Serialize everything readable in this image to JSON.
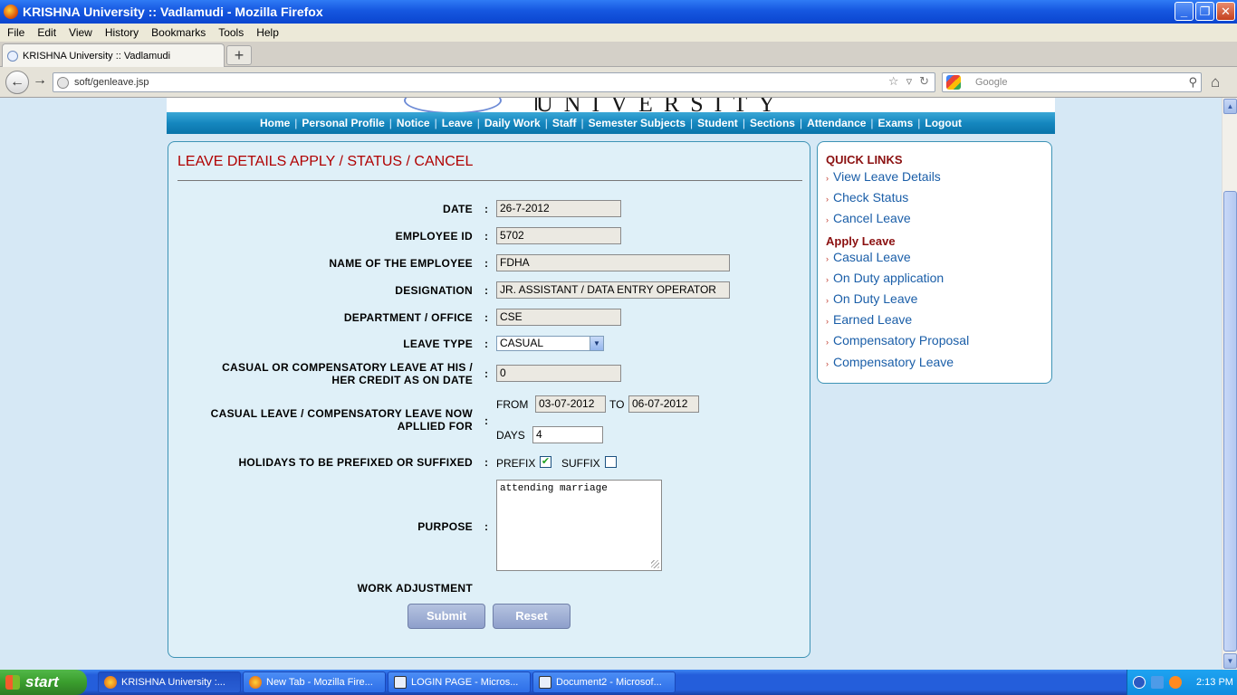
{
  "window": {
    "title": "KRISHNA University :: Vadlamudi - Mozilla Firefox"
  },
  "menu": [
    "File",
    "Edit",
    "View",
    "History",
    "Bookmarks",
    "Tools",
    "Help"
  ],
  "tab": {
    "title": "KRISHNA University :: Vadlamudi"
  },
  "address": {
    "url": "soft/genleave.jsp"
  },
  "search": {
    "placeholder": "Google"
  },
  "banner": {
    "word": "UNIVERSITY"
  },
  "nav": [
    "Home",
    "Personal Profile",
    "Notice",
    "Leave",
    "Daily Work",
    "Staff",
    "Semester Subjects",
    "Student",
    "Sections",
    "Attendance",
    "Exams",
    "Logout"
  ],
  "form": {
    "title": "LEAVE DETAILS APPLY / STATUS / CANCEL",
    "date_label": "DATE",
    "date_value": "26-7-2012",
    "empid_label": "EMPLOYEE ID",
    "empid_value": "5702",
    "name_label": "NAME OF THE EMPLOYEE",
    "name_value": "FDHA",
    "designation_label": "DESIGNATION",
    "designation_value": "JR. ASSISTANT / DATA ENTRY OPERATOR",
    "dept_label": "DEPARTMENT / OFFICE",
    "dept_value": "CSE",
    "leave_type_label": "LEAVE TYPE",
    "leave_type_value": "CASUAL",
    "credit_label_1": "CASUAL OR COMPENSATORY LEAVE AT HIS /",
    "credit_label_2": "HER CREDIT AS ON DATE",
    "credit_value": "0",
    "applied_label_1": "CASUAL LEAVE / COMPENSATORY LEAVE NOW",
    "applied_label_2": "APLLIED FOR",
    "from_label": "FROM",
    "from_value": "03-07-2012",
    "to_label": "TO",
    "to_value": "06-07-2012",
    "days_label": "DAYS",
    "days_value": "4",
    "holidays_label": "HOLIDAYS TO BE PREFIXED OR SUFFIXED",
    "prefix_label": "PREFIX",
    "prefix_checked": true,
    "suffix_label": "SUFFIX",
    "suffix_checked": false,
    "purpose_label": "PURPOSE",
    "purpose_value": "attending marriage",
    "work_adjustment_label": "WORK ADJUSTMENT",
    "colon": ":",
    "submit_label": "Submit",
    "reset_label": "Reset"
  },
  "quicklinks": {
    "heading": "QUICK LINKS",
    "items": [
      "View Leave Details",
      "Check Status",
      "Cancel Leave"
    ],
    "apply_heading": "Apply Leave",
    "apply_items": [
      "Casual Leave",
      "On Duty application",
      "On Duty Leave",
      "Earned Leave",
      "Compensatory Proposal",
      "Compensatory Leave"
    ]
  },
  "taskbar": {
    "start_label": "start",
    "tasks": [
      "KRISHNA University :...",
      "New Tab - Mozilla Fire...",
      "LOGIN PAGE - Micros...",
      "Document2 - Microsof..."
    ],
    "clock": "2:13 PM"
  },
  "colors": {
    "accent": "#1587bf",
    "title_red": "#b00000",
    "link_blue": "#1a5ea8"
  }
}
